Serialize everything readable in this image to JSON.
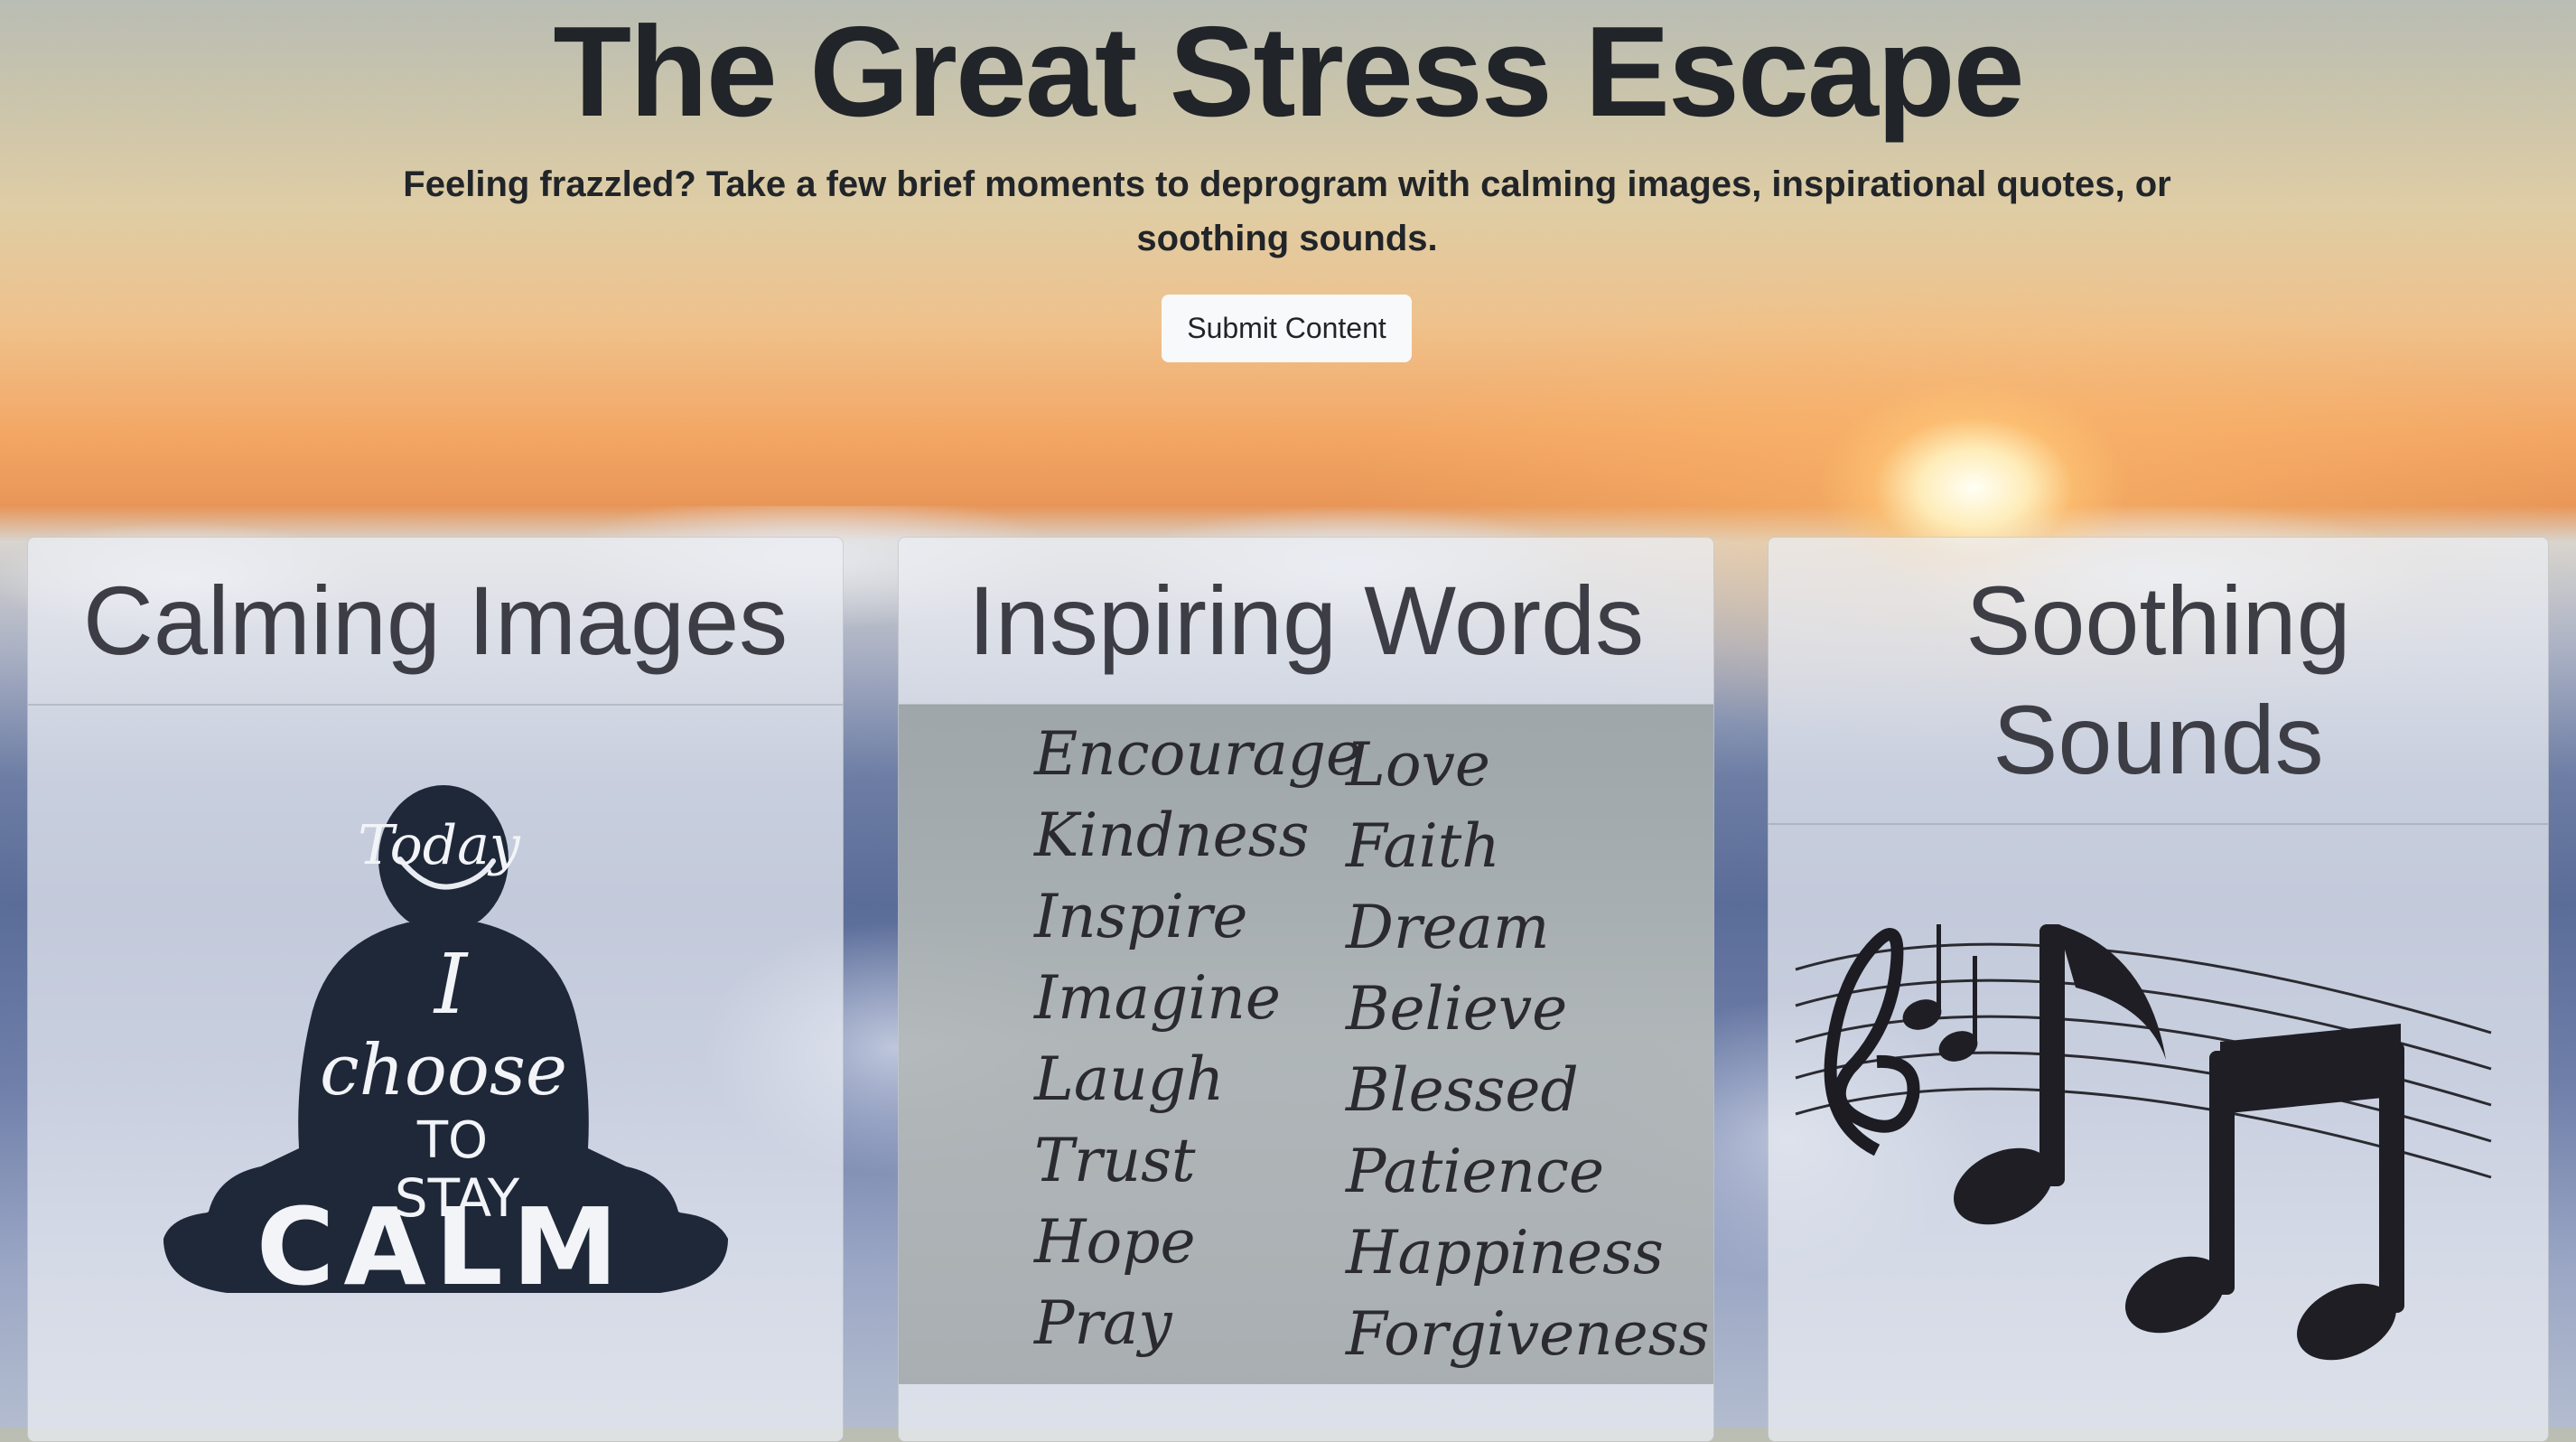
{
  "header": {
    "title": "The Great Stress Escape",
    "subtitle": "Feeling frazzled? Take a few brief moments to deprogram with calming images, inspirational quotes, or soothing sounds.",
    "submit_label": "Submit Content"
  },
  "cards": [
    {
      "title": "Calming Images",
      "image_text": {
        "line1": "Today",
        "line2": "I",
        "line3": "choose",
        "line4": "TO",
        "line5": "STAY",
        "line6": "CALM"
      }
    },
    {
      "title": "Inspiring Words",
      "words_left": [
        "Encourage",
        "Kindness",
        "Inspire",
        "Imagine",
        "Laugh",
        "Trust",
        "Hope",
        "Pray"
      ],
      "words_right": [
        "Love",
        "Faith",
        "Dream",
        "Believe",
        "Blessed",
        "Patience",
        "Happiness",
        "Forgiveness"
      ]
    },
    {
      "title_line1": "Soothing",
      "title_line2": "Sounds"
    }
  ],
  "colors": {
    "text_dark": "#212529",
    "button_bg": "#f8f9fa",
    "card_title": "#3d3d45",
    "silhouette": "#1f2838"
  },
  "icons": [
    "meditation-silhouette-icon",
    "music-notes-icon"
  ]
}
